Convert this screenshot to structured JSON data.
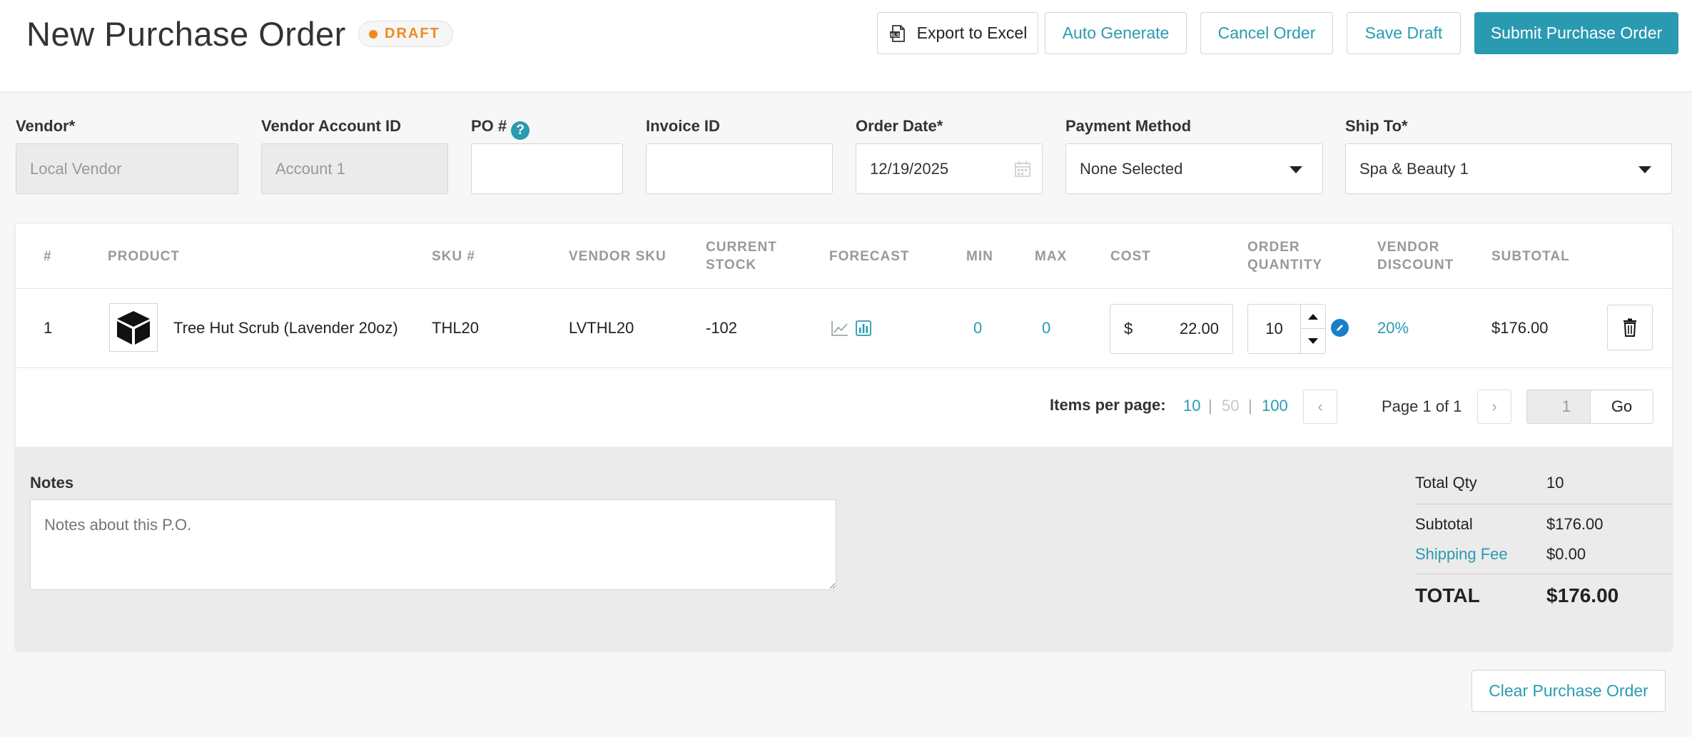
{
  "header": {
    "title": "New Purchase Order",
    "status_badge": "DRAFT",
    "export_label": "Export to Excel",
    "auto_generate_label": "Auto Generate",
    "cancel_label": "Cancel Order",
    "save_draft_label": "Save Draft",
    "submit_label": "Submit Purchase Order"
  },
  "form": {
    "vendor_label": "Vendor*",
    "vendor_value": "Local Vendor",
    "vendor_account_label": "Vendor Account ID",
    "vendor_account_value": "Account 1",
    "po_label": "PO #",
    "po_help": "?",
    "po_value": "",
    "invoice_label": "Invoice ID",
    "invoice_value": "",
    "order_date_label": "Order Date*",
    "order_date_value": "12/19/2025",
    "payment_label": "Payment Method",
    "payment_value": "None Selected",
    "ship_to_label": "Ship To*",
    "ship_to_value": "Spa & Beauty 1"
  },
  "table": {
    "columns": [
      "#",
      "PRODUCT",
      "SKU #",
      "VENDOR SKU",
      "CURRENT STOCK",
      "FORECAST",
      "MIN",
      "MAX",
      "COST",
      "ORDER QUANTITY",
      "VENDOR DISCOUNT",
      "SUBTOTAL"
    ],
    "rows": [
      {
        "index": "1",
        "product": "Tree Hut Scrub (Lavender 20oz)",
        "sku": "THL20",
        "vendor_sku": "LVTHL20",
        "current_stock": "-102",
        "min": "0",
        "max": "0",
        "cost_currency": "$",
        "cost": "22.00",
        "order_quantity": "10",
        "vendor_discount": "20%",
        "subtotal": "$176.00"
      }
    ]
  },
  "pager": {
    "items_per_page_label": "Items per page:",
    "options": [
      "10",
      "50",
      "100"
    ],
    "separator": "|",
    "prev": "‹",
    "next": "›",
    "page_info": "Page 1 of 1",
    "page_input": "1",
    "go_label": "Go"
  },
  "notes": {
    "label": "Notes",
    "placeholder": "Notes about this P.O."
  },
  "totals": {
    "total_qty_label": "Total Qty",
    "total_qty_value": "10",
    "subtotal_label": "Subtotal",
    "subtotal_value": "$176.00",
    "shipping_fee_label": "Shipping Fee",
    "shipping_fee_value": "$0.00",
    "total_label": "TOTAL",
    "total_value": "$176.00"
  },
  "footer": {
    "clear_label": "Clear Purchase Order"
  },
  "colors": {
    "accent": "#2a9ab1",
    "draft": "#ef8a1e",
    "edit_icon": "#1a7fc8"
  },
  "icons": {
    "export": "excel-file-icon",
    "calendar": "calendar-icon",
    "product_thumb": "box-icon",
    "forecast_line": "line-chart-icon",
    "forecast_bar": "bar-chart-icon",
    "edit": "pencil-icon",
    "delete": "trash-icon"
  }
}
